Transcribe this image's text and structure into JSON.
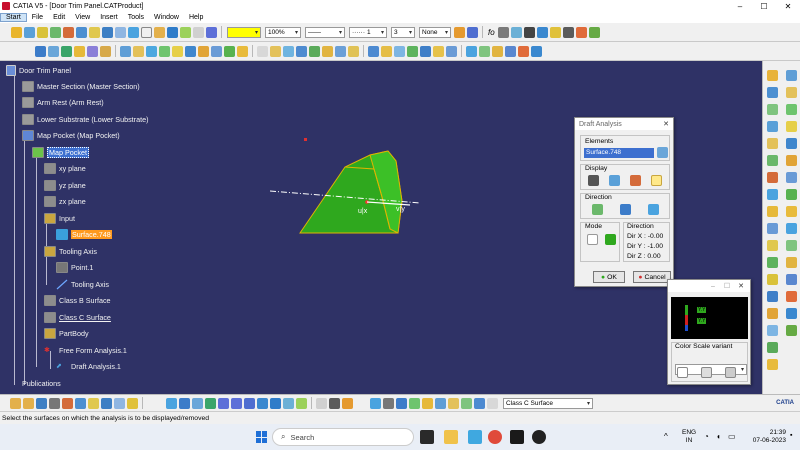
{
  "window": {
    "title": "CATIA V5 - [Door Trim Panel.CATProduct]",
    "controls": [
      "–",
      "☐",
      "✕"
    ]
  },
  "menu": [
    "Start",
    "File",
    "Edit",
    "View",
    "Insert",
    "Tools",
    "Window",
    "Help"
  ],
  "toolbar": {
    "color_value": "",
    "transparency_value": "100%",
    "linetype_value": "1",
    "layer_value": "3",
    "none_value": "None",
    "fo_label": "fo"
  },
  "tree": {
    "root": "Door Trim Panel",
    "items": [
      {
        "label": "Master Section (Master Section)"
      },
      {
        "label": "Arm Rest (Arm Rest)"
      },
      {
        "label": "Lower Substrate (Lower Substrate)"
      },
      {
        "label": "Map Pocket (Map Pocket)"
      },
      {
        "label": "Map Pocket"
      },
      {
        "label": "xy plane"
      },
      {
        "label": "yz plane"
      },
      {
        "label": "zx plane"
      },
      {
        "label": "Input"
      },
      {
        "label": "Surface.748"
      },
      {
        "label": "Tooling Axis"
      },
      {
        "label": "Point.1"
      },
      {
        "label": "Tooling Axis"
      },
      {
        "label": "Class B Surface"
      },
      {
        "label": "Class C Surface"
      },
      {
        "label": "PartBody"
      },
      {
        "label": "Free Form Analysis.1"
      },
      {
        "label": "Draft Analysis.1"
      },
      {
        "label": "Publications"
      }
    ]
  },
  "draft_dialog": {
    "title": "Draft Analysis",
    "elements_label": "Elements",
    "elements_value": "Surface.748",
    "display_label": "Display",
    "direction_label": "Direction",
    "mode_label": "Mode",
    "direction_group_label": "Direction",
    "dir_x": "Dir X : -0.00",
    "dir_y": "Dir Y : -1.00",
    "dir_z": "Dir Z :  0.00",
    "ok_label": "OK",
    "cancel_label": "Cancel"
  },
  "color_scale_dialog": {
    "controls": [
      "–",
      "☐",
      "✕"
    ],
    "variant_label": "Color Scale variant",
    "scale_values": [
      "Y.Y",
      "Y.Y"
    ]
  },
  "viewport": {
    "axis_labels": [
      "u|x",
      "v|y"
    ]
  },
  "bottom_toolbar": {
    "combo_value": "Class C Surface"
  },
  "status_text": "Select the surfaces on which the analysis is to be displayed/removed",
  "taskbar": {
    "search_placeholder": "Search",
    "lang_1": "ENG",
    "lang_2": "IN",
    "time": "21:39",
    "date": "07-06-2023"
  },
  "logo_text": "CATIA",
  "colors": {
    "viewport_bg": "#2f3266",
    "surface_green": "#2fa81e",
    "surface_edge": "#e0b400",
    "selection_blue": "#3d6fcf",
    "highlight_orange": "#ff9a1f"
  }
}
